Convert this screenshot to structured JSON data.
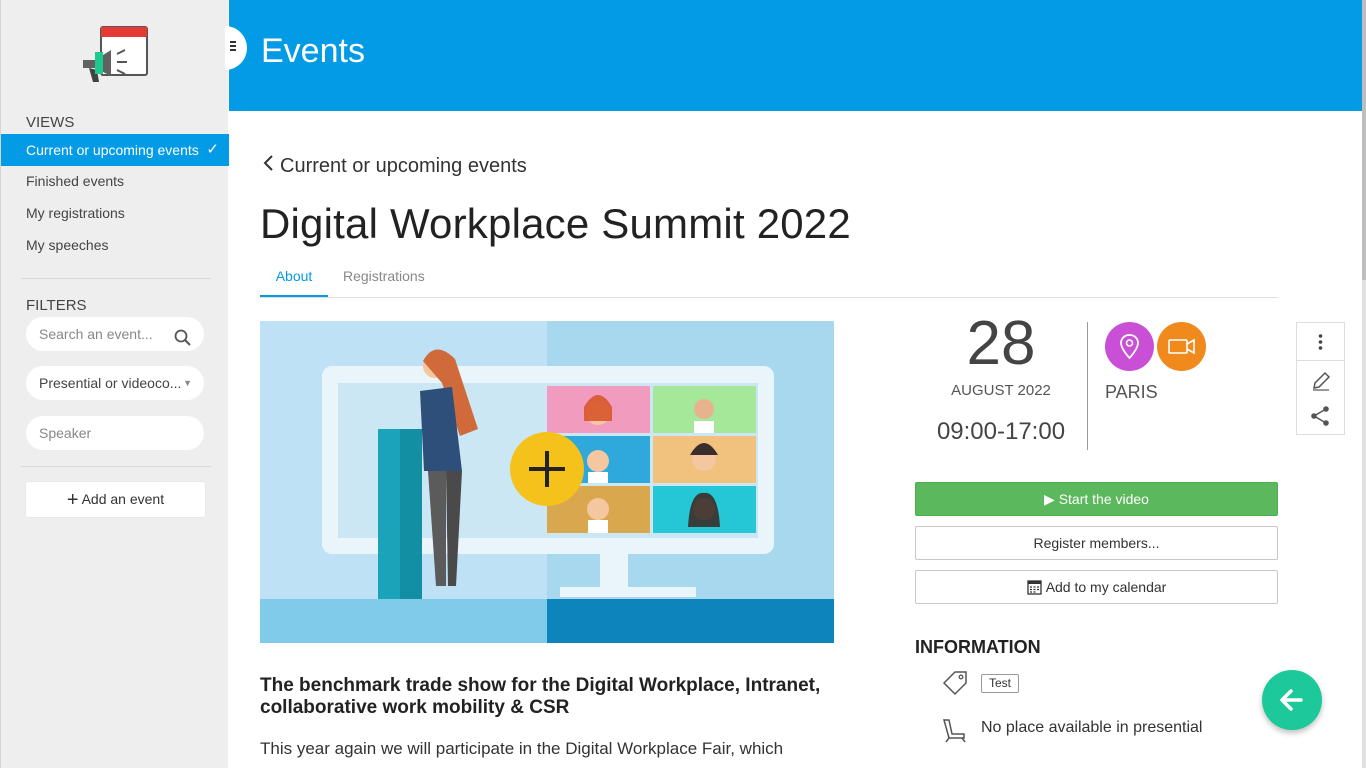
{
  "sidebar": {
    "views_title": "VIEWS",
    "views": [
      {
        "label": "Current or upcoming events",
        "active": true
      },
      {
        "label": "Finished events"
      },
      {
        "label": "My registrations"
      },
      {
        "label": "My speeches"
      }
    ],
    "filters_title": "FILTERS",
    "search_placeholder": "Search an event...",
    "type_filter": "Presential or videoco...",
    "speaker_placeholder": "Speaker",
    "add_event_label": "Add an event"
  },
  "header": {
    "title": "Events"
  },
  "content": {
    "back_label": "Current or upcoming events",
    "event_title": "Digital Workplace Summit 2022",
    "tabs": [
      "About",
      "Registrations"
    ],
    "subtitle": "The benchmark trade show for the Digital Workplace, Intranet, collaborative work mobility & CSR",
    "paragraph": "This year again we will participate in the Digital Workplace Fair, which"
  },
  "event": {
    "day": "28",
    "month_year": "AUGUST 2022",
    "time": "09:00-17:00",
    "city": "PARIS",
    "start_video_label": "Start the video",
    "register_members_label": "Register members...",
    "add_calendar_label": "Add to my calendar"
  },
  "information": {
    "title": "INFORMATION",
    "tag": "Test",
    "availability": "No place available in presential"
  },
  "colors": {
    "primary": "#039be5",
    "green": "#5cb85c",
    "location": "#c94fd6",
    "video": "#f08a1c",
    "fab": "#1dc99a"
  }
}
